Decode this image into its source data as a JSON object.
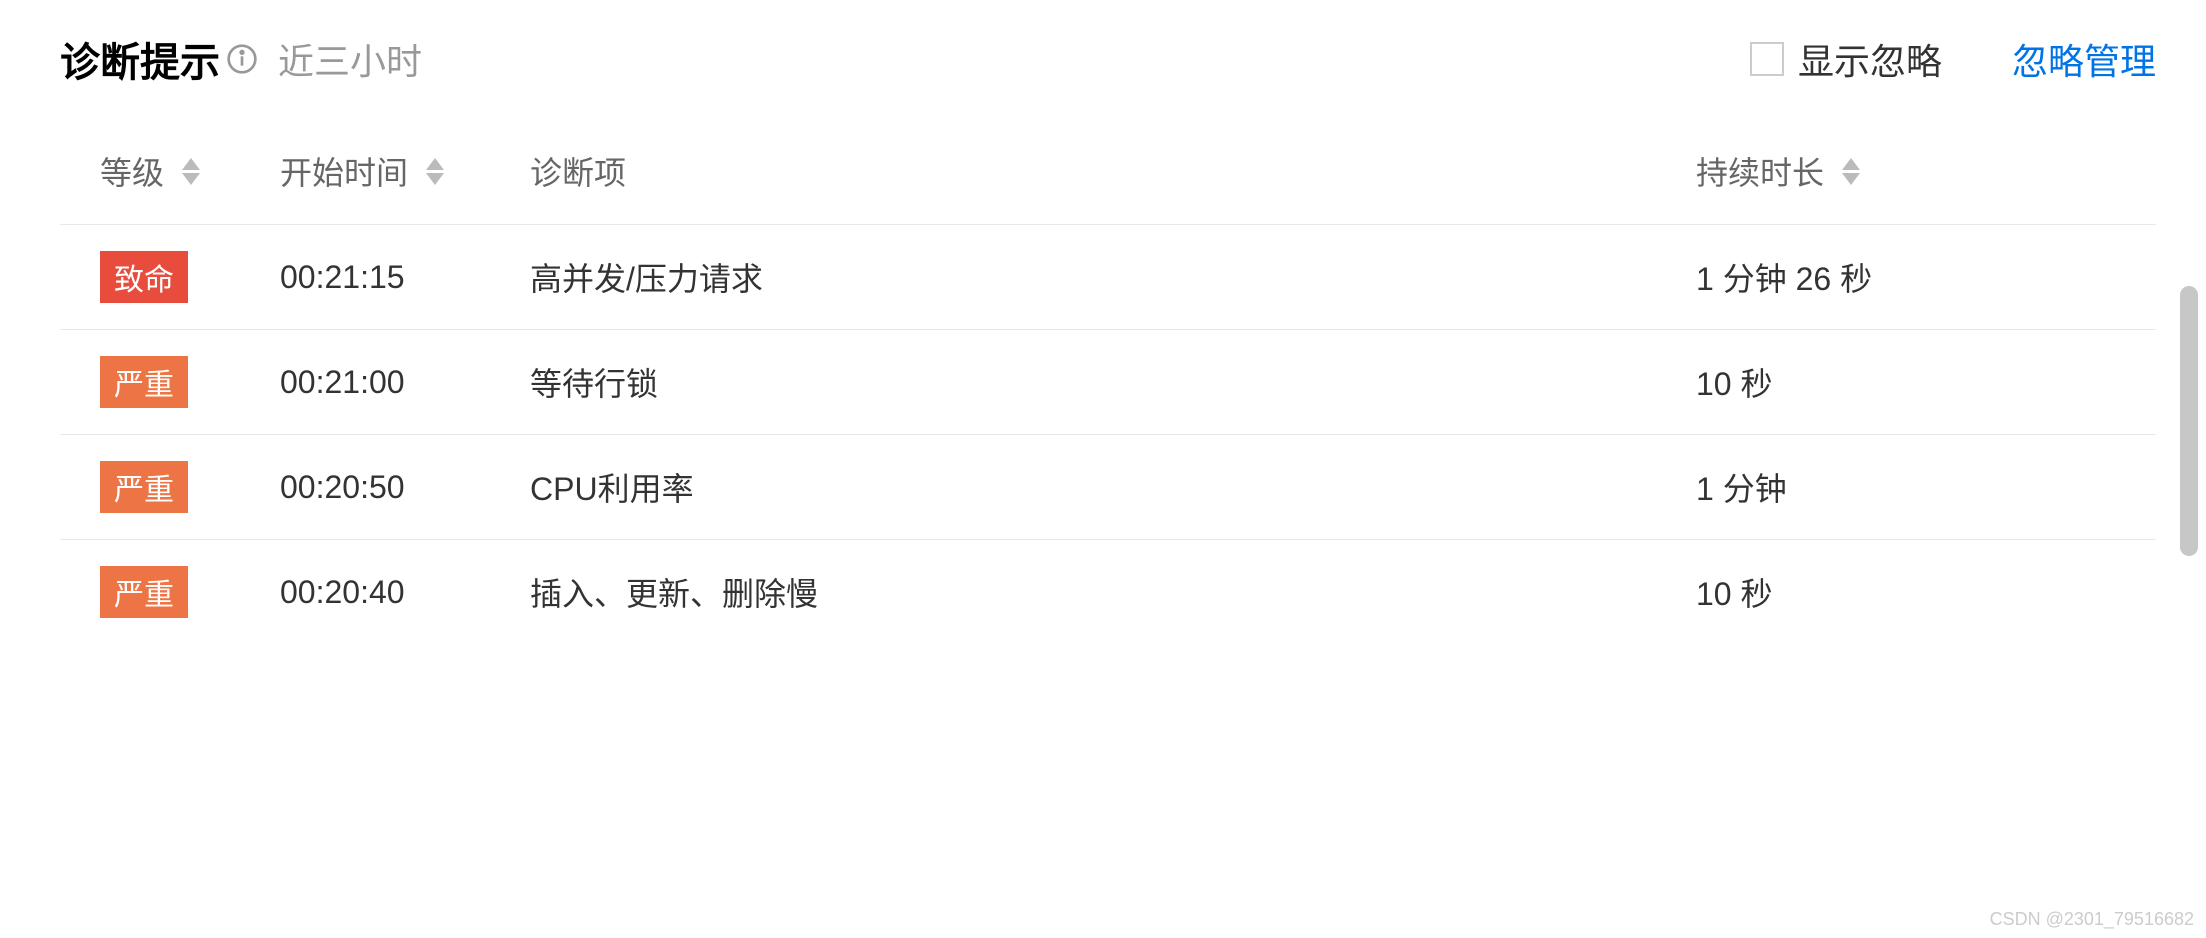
{
  "header": {
    "title": "诊断提示",
    "subtitle": "近三小时",
    "checkbox_label": "显示忽略",
    "manage_link": "忽略管理"
  },
  "table": {
    "columns": {
      "level": "等级",
      "start_time": "开始时间",
      "diagnosis_item": "诊断项",
      "duration": "持续时长"
    },
    "rows": [
      {
        "level": "致命",
        "level_type": "fatal",
        "start_time": "00:21:15",
        "diagnosis_item": "高并发/压力请求",
        "duration": "1 分钟 26 秒"
      },
      {
        "level": "严重",
        "level_type": "critical",
        "start_time": "00:21:00",
        "diagnosis_item": "等待行锁",
        "duration": "10 秒"
      },
      {
        "level": "严重",
        "level_type": "critical",
        "start_time": "00:20:50",
        "diagnosis_item": "CPU利用率",
        "duration": "1 分钟"
      },
      {
        "level": "严重",
        "level_type": "critical",
        "start_time": "00:20:40",
        "diagnosis_item": "插入、更新、删除慢",
        "duration": "10 秒"
      }
    ]
  },
  "watermark": "CSDN @2301_79516682"
}
